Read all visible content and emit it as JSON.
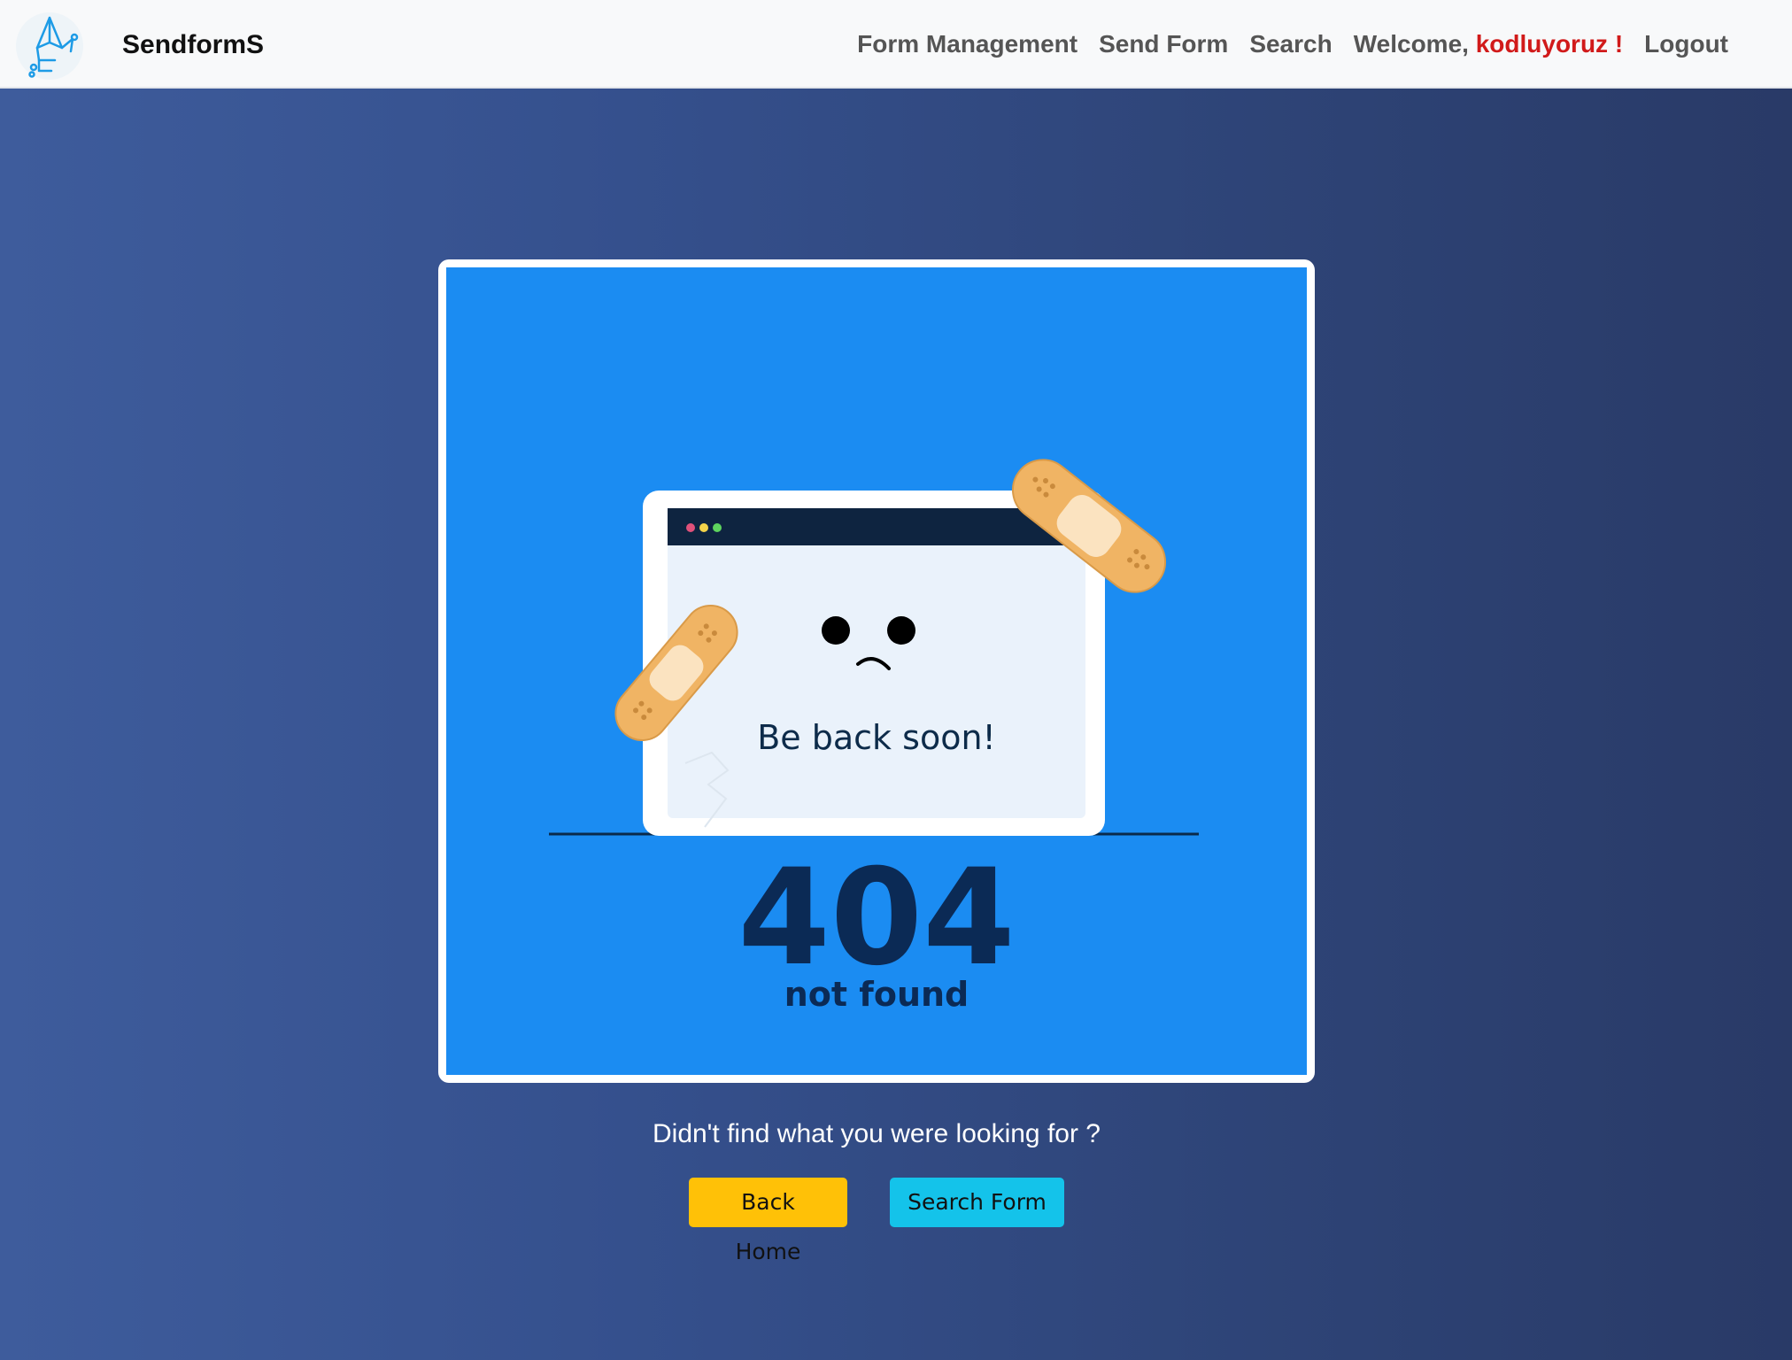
{
  "navbar": {
    "brand": "SendformS",
    "links": {
      "form_management": "Form Management",
      "send_form": "Send Form",
      "search": "Search",
      "welcome_prefix": "Welcome, ",
      "username": "kodluyoruz",
      "welcome_suffix": " !",
      "logout": "Logout"
    }
  },
  "illustration": {
    "headline": "Be back soon!",
    "code": "404",
    "subtitle": "not found"
  },
  "footer": {
    "prompt": "Didn't find what you were looking for ?",
    "back_home": "Back Home",
    "search_form": "Search Form"
  },
  "colors": {
    "navbar_bg": "#f8f9fa",
    "username": "#d11a1a",
    "illustration_bg": "#1b8cf2",
    "back_home_button": "#ffc107",
    "search_form_button": "#14c3ea"
  },
  "icons": {
    "logo": "sendforms-logo-icon",
    "bandage": "bandage-icon"
  }
}
